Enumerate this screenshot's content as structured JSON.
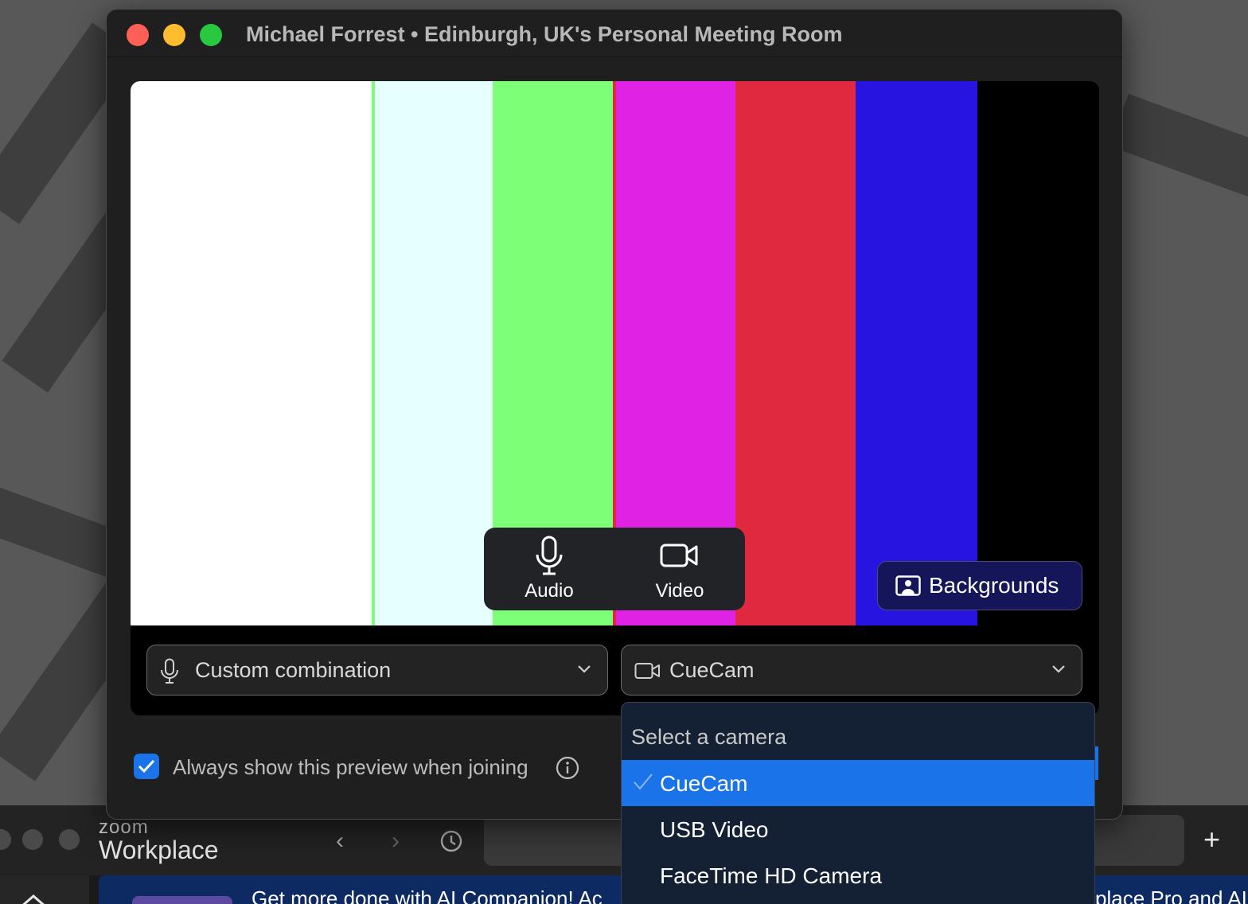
{
  "window": {
    "title": "Michael Forrest • Edinburgh, UK's Personal Meeting Room"
  },
  "preview": {
    "color_bars": [
      "#ffffff",
      "#e6ffff",
      "#7dff78",
      "#e022e4",
      "#e0283f",
      "#2814e0",
      "#000000"
    ]
  },
  "controls": {
    "audio_label": "Audio",
    "video_label": "Video",
    "backgrounds_label": "Backgrounds"
  },
  "audio_select": {
    "value": "Custom combination"
  },
  "camera_select": {
    "value": "CueCam"
  },
  "preview_option": {
    "label": "Always show this preview when joining",
    "checked": true
  },
  "camera_menu": {
    "header": "Select a camera",
    "items": [
      {
        "label": "CueCam",
        "selected": true
      },
      {
        "label": "USB Video",
        "selected": false
      },
      {
        "label": "FaceTime HD Camera",
        "selected": false
      }
    ]
  },
  "zoom_app": {
    "brand_small": "zoom",
    "brand_large": "Workplace",
    "banner_text": "Get more done with AI Companion! Ac",
    "banner_text_right": "place Pro and AI"
  },
  "colors": {
    "accent": "#1a73e8",
    "window_bg": "#1f1f1f",
    "menu_bg": "#142033"
  }
}
